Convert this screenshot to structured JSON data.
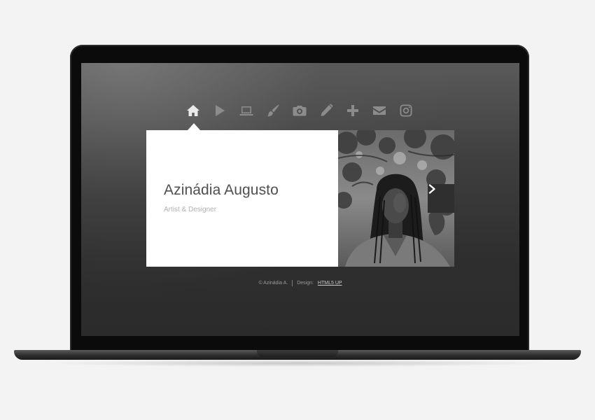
{
  "nav": {
    "items": [
      {
        "id": "home",
        "icon": "home-icon",
        "active": true
      },
      {
        "id": "play",
        "icon": "play-icon",
        "active": false
      },
      {
        "id": "laptop",
        "icon": "laptop-icon",
        "active": false
      },
      {
        "id": "brush",
        "icon": "paintbrush-icon",
        "active": false
      },
      {
        "id": "camera",
        "icon": "camera-icon",
        "active": false
      },
      {
        "id": "pencil",
        "icon": "pencil-icon",
        "active": false
      },
      {
        "id": "plus",
        "icon": "plus-icon",
        "active": false
      },
      {
        "id": "mail",
        "icon": "envelope-icon",
        "active": false
      },
      {
        "id": "instagram",
        "icon": "instagram-icon",
        "active": false
      }
    ]
  },
  "profile": {
    "name": "Azinádia Augusto",
    "subtitle": "Artist & Designer"
  },
  "footer": {
    "copyright": "© Azinádia A.",
    "design_label": "Design:",
    "design_link": "HTML5 UP"
  },
  "colors": {
    "icon_inactive": "#8c8c8c",
    "icon_active": "#eaeaea",
    "card_bg": "#ffffff",
    "next_button_bg": "#2f2f2f"
  }
}
